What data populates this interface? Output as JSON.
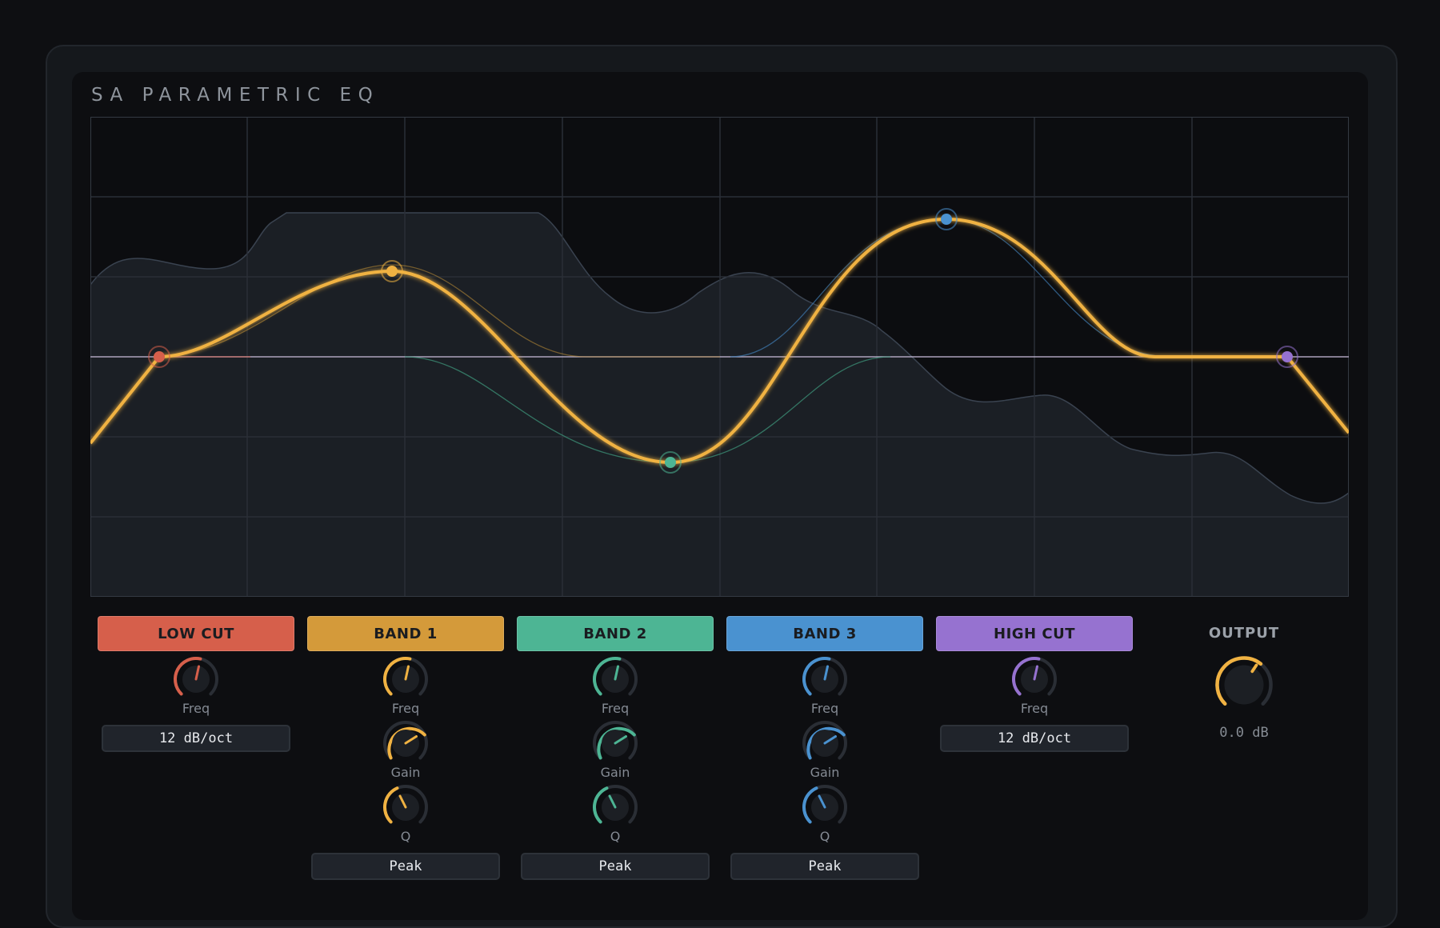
{
  "app": {
    "title": "SA PARAMETRIC EQ"
  },
  "colors": {
    "low_cut": "#d65f4b",
    "band1": "#d49a3a",
    "band2": "#4db594",
    "band3": "#4a92d0",
    "high_cut": "#9672d0",
    "curve": "#f0b242",
    "output": "#f0b242"
  },
  "bands": [
    {
      "id": "low_cut",
      "label": "LOW CUT",
      "freq_label": "Freq",
      "slope": "12 dB/oct"
    },
    {
      "id": "band1",
      "label": "BAND 1",
      "freq_label": "Freq",
      "gain_label": "Gain",
      "q_label": "Q",
      "type": "Peak"
    },
    {
      "id": "band2",
      "label": "BAND 2",
      "freq_label": "Freq",
      "gain_label": "Gain",
      "q_label": "Q",
      "type": "Peak"
    },
    {
      "id": "band3",
      "label": "BAND 3",
      "freq_label": "Freq",
      "gain_label": "Gain",
      "q_label": "Q",
      "type": "Peak"
    },
    {
      "id": "high_cut",
      "label": "HIGH CUT",
      "freq_label": "Freq",
      "slope": "12 dB/oct"
    }
  ],
  "output": {
    "label": "OUTPUT",
    "value": "0.0 dB"
  }
}
